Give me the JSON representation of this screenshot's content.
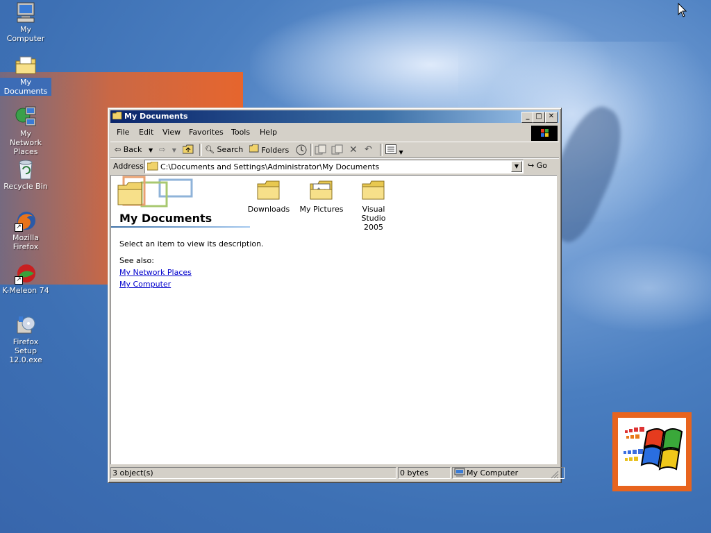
{
  "desktop": {
    "icons": [
      {
        "label": "My Computer"
      },
      {
        "label": "My Documents"
      },
      {
        "label": "My Network Places"
      },
      {
        "label": "Recycle Bin"
      },
      {
        "label": "Mozilla Firefox"
      },
      {
        "label": "K-Meleon 74"
      },
      {
        "label": "Firefox Setup 12.0.exe"
      }
    ]
  },
  "window": {
    "title": "My Documents",
    "controls": {
      "minimize": "_",
      "maximize": "□",
      "close": "✕"
    },
    "menu": [
      "File",
      "Edit",
      "View",
      "Favorites",
      "Tools",
      "Help"
    ],
    "toolbar": {
      "back": "Back",
      "search": "Search",
      "folders": "Folders"
    },
    "address": {
      "label": "Address",
      "value": "C:\\Documents and Settings\\Administrator\\My Documents",
      "go": "Go"
    },
    "sidepanel": {
      "heading": "My Documents",
      "description": "Select an item to view its description.",
      "see_also": "See also:",
      "links": [
        "My Network Places",
        "My Computer"
      ]
    },
    "items": [
      {
        "label": "Downloads"
      },
      {
        "label": "My Pictures"
      },
      {
        "label": "Visual Studio 2005"
      }
    ],
    "status": {
      "objects": "3 object(s)",
      "size": "0 bytes",
      "zone": "My Computer"
    }
  }
}
